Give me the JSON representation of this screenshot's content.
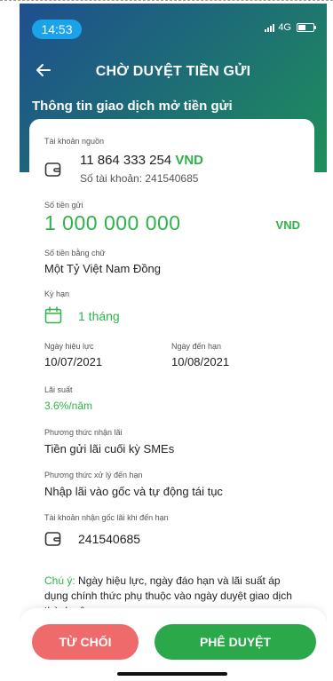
{
  "status_bar": {
    "time": "14:53",
    "network": "4G"
  },
  "nav": {
    "title": "CHỜ DUYỆT TIỀN GỬI"
  },
  "subtitle": "Thông tin giao dịch mở tiền gửi",
  "source_account": {
    "label": "Tài khoản nguồn",
    "balance": "11 864 333 254",
    "currency": "VND",
    "account_number_text": "Số tài khoản: 241540685"
  },
  "deposit_amount": {
    "label": "Số tiền gửi",
    "value": "1 000 000 000",
    "currency": "VND"
  },
  "amount_in_words": {
    "label": "Số tiền bằng chữ",
    "value": "Một Tỷ Việt Nam Đồng"
  },
  "term": {
    "label": "Kỳ hạn",
    "value": "1 tháng"
  },
  "effective_date": {
    "label": "Ngày hiệu lực",
    "value": "10/07/2021"
  },
  "maturity_date": {
    "label": "Ngày đến hạn",
    "value": "10/08/2021"
  },
  "interest_rate": {
    "label": "Lãi suất",
    "value": "3.6%/năm"
  },
  "interest_method": {
    "label": "Phương thức nhận lãi",
    "value": "Tiền gửi lãi cuối kỳ SMEs"
  },
  "maturity_method": {
    "label": "Phương thức xử lý đến hạn",
    "value": "Nhập lãi vào gốc và tự động tái tục"
  },
  "receiving_account": {
    "label": "Tài khoản nhận gốc lãi khi đến hạn",
    "value": "241540685"
  },
  "note": {
    "label": "Chú ý:",
    "text": " Ngày hiệu lực, ngày đáo hạn và lãi suất áp dụng chính thức phụ thuộc vào ngày duyệt giao dịch thành công."
  },
  "actions": {
    "reject_label": "TỪ CHỐI",
    "approve_label": "PHÊ DUYỆT"
  },
  "colors": {
    "accent_green": "#2db34a",
    "reject_red": "#ef6b6b",
    "approve_green": "#2aa84a",
    "time_pill_blue": "#1aa3e8"
  }
}
